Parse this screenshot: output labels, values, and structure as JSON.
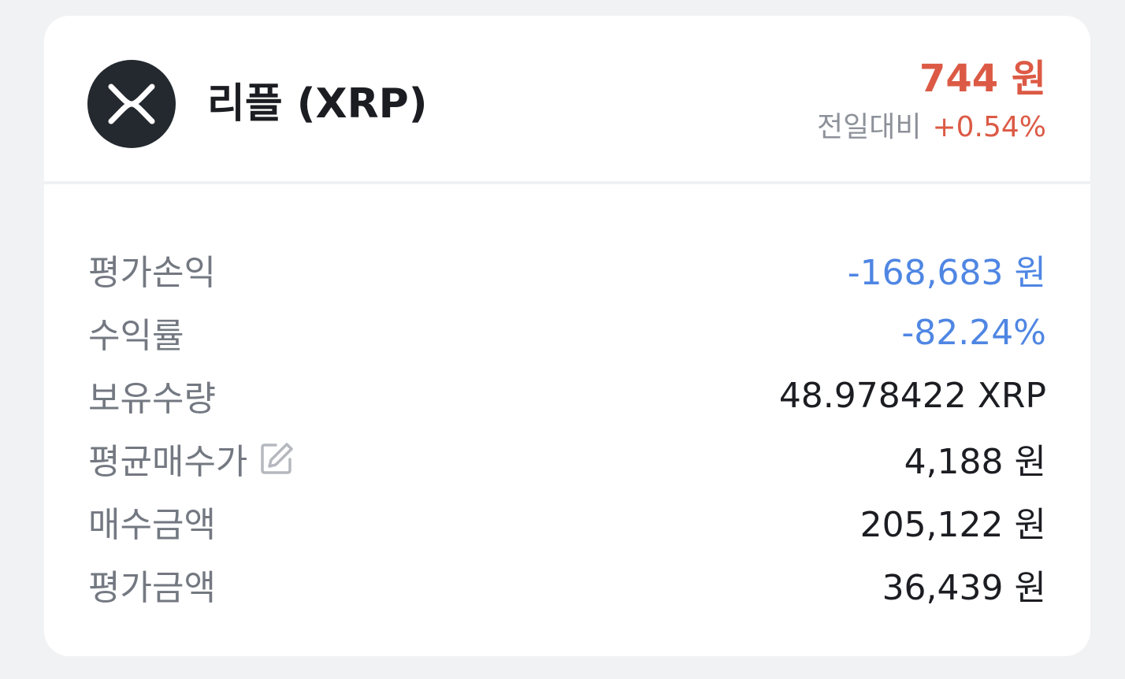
{
  "coin": {
    "name": "리플 (XRP)",
    "logo_icon": "xrp-logo-icon",
    "price": "744 원",
    "change_label": "전일대비",
    "change_value": "+0.54%"
  },
  "colors": {
    "up": "#dc5a45",
    "down": "#4f86e3",
    "text": "#1c1d22",
    "label": "#737881",
    "background": "#f1f2f4",
    "logo_bg": "#23292f"
  },
  "details": {
    "rows": [
      {
        "label": "평가손익",
        "value": "-168,683 원",
        "tone": "negative"
      },
      {
        "label": "수익률",
        "value": "-82.24%",
        "tone": "negative"
      },
      {
        "label": "보유수량",
        "value": "48.978422 XRP",
        "tone": "neutral"
      },
      {
        "label": "평균매수가",
        "value": "4,188 원",
        "tone": "neutral",
        "icon": "edit-icon"
      },
      {
        "label": "매수금액",
        "value": "205,122 원",
        "tone": "neutral"
      },
      {
        "label": "평가금액",
        "value": "36,439 원",
        "tone": "neutral"
      }
    ]
  }
}
